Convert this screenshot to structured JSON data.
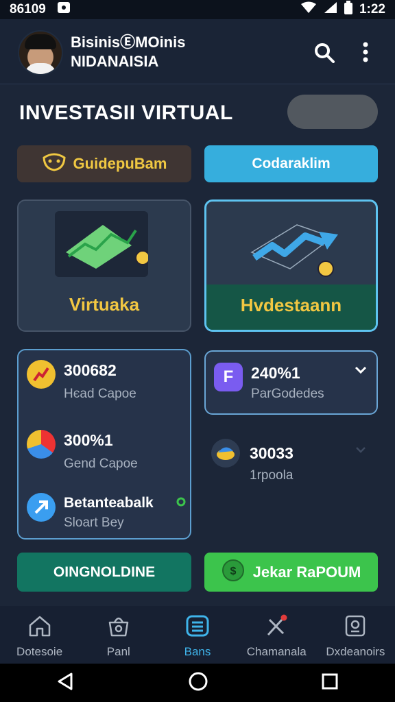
{
  "status_bar": {
    "time_left": "86109",
    "time_right": "1:22"
  },
  "profile": {
    "line1": "BisinisⒺMOinis",
    "line2": "NIDANAISIA"
  },
  "page": {
    "heading": "INVESTASII VIRTUAL"
  },
  "actions": {
    "guide_label": "GuideрuBam",
    "cod_label": "Codaraklim"
  },
  "cards": {
    "virtual_label": "Virtuaka",
    "invest_label": "Hvdestaann"
  },
  "list": [
    {
      "value": "300682",
      "subtitle": "Hєad Capoe",
      "icon": "trend-icon"
    },
    {
      "value": "300%1",
      "subtitle": "Gend Capoe",
      "icon": "chart-ring-icon"
    },
    {
      "value": "Betanteabalk",
      "subtitle": "Sloart Bey",
      "icon": "arrow-up-icon"
    }
  ],
  "dropdown": {
    "value": "240%1",
    "subtitle": "ParGodedes",
    "icon": "f-app-icon"
  },
  "extra_item": {
    "value": "30033",
    "subtitle": "1rpoola"
  },
  "bottom_buttons": {
    "online_label": "OINGNOLDINE",
    "jek_label": "Jekar RaPOUM"
  },
  "nav": [
    {
      "label": "Dotesoie",
      "icon": "home-icon"
    },
    {
      "label": "Panl",
      "icon": "bag-icon"
    },
    {
      "label": "Bans",
      "icon": "list-icon",
      "active": true
    },
    {
      "label": "Chamanala",
      "icon": "tools-icon"
    },
    {
      "label": "Dxdeanoirs",
      "icon": "wallet-icon"
    }
  ],
  "colors": {
    "background": "#1c2638",
    "accent_blue": "#36aedd",
    "gold": "#f2c742",
    "green": "#3cc44c",
    "teal": "#127561"
  }
}
